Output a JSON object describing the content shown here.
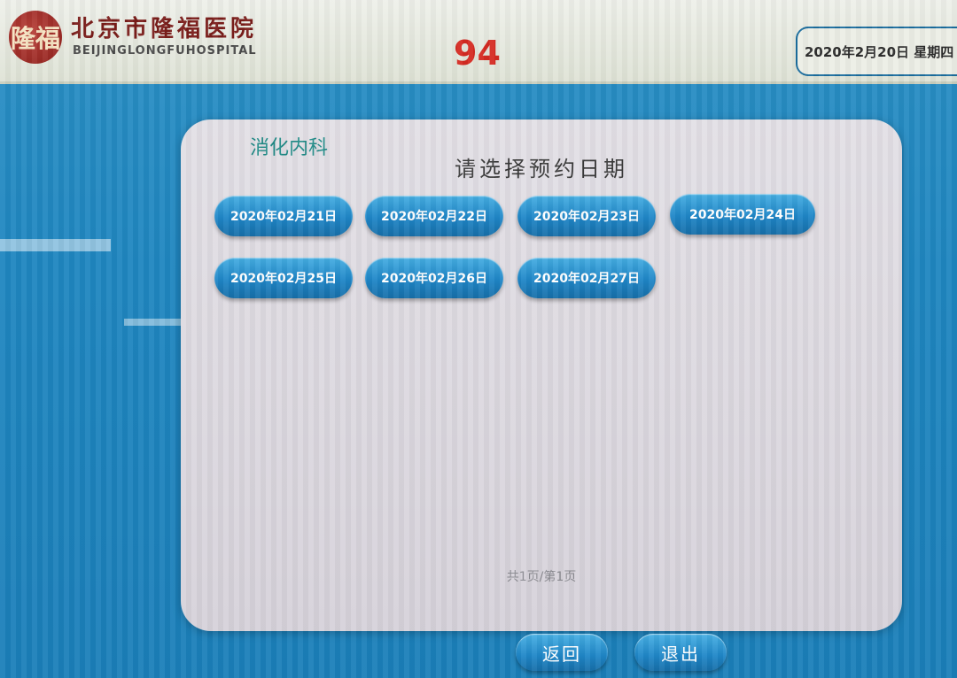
{
  "header": {
    "logo_text": "隆福",
    "hospital_name": "北京市隆福医院",
    "hospital_name_en": "BEIJINGLONGFUHOSPITAL",
    "queue_number": "94",
    "date_text": "2020年2月20日  星期四"
  },
  "panel": {
    "department": "消化内科",
    "prompt": "请选择预约日期",
    "dates": [
      "2020年02月21日",
      "2020年02月22日",
      "2020年02月23日",
      "2020年02月24日",
      "2020年02月25日",
      "2020年02月26日",
      "2020年02月27日"
    ],
    "pager": "共1页/第1页"
  },
  "footer": {
    "back_label": "返回",
    "exit_label": "退出"
  },
  "colors": {
    "background": "#1f86c0",
    "button": "#1f86c7",
    "queue_number": "#d52a22",
    "department": "#1f8a86"
  }
}
